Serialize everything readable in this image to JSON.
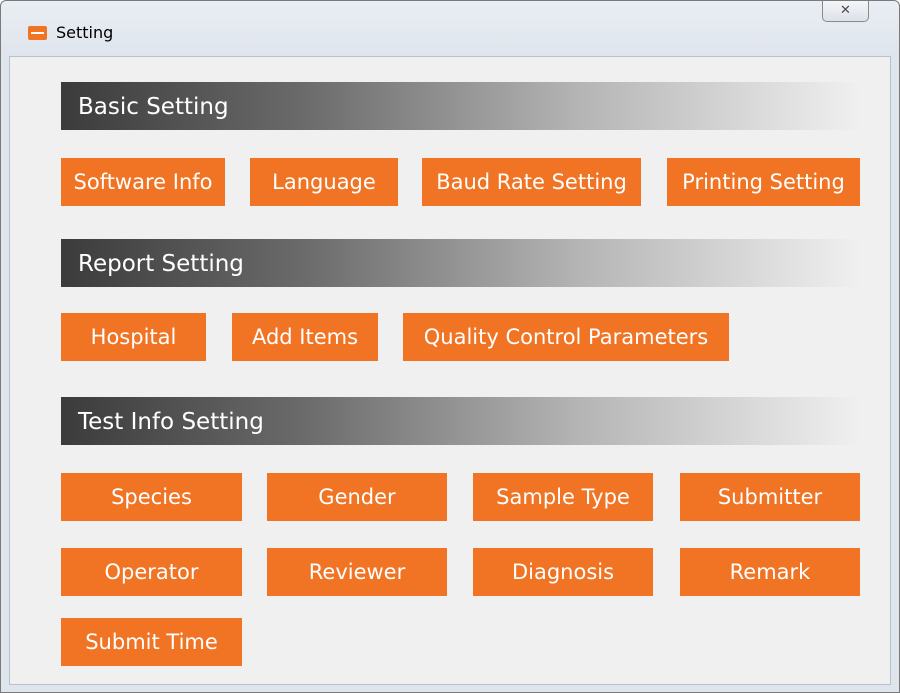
{
  "window": {
    "title": "Setting",
    "close_label": "✕"
  },
  "sections": {
    "basic": {
      "title": "Basic Setting",
      "buttons": [
        "Software Info",
        "Language",
        "Baud Rate Setting",
        "Printing Setting"
      ]
    },
    "report": {
      "title": "Report Setting",
      "buttons": [
        "Hospital",
        "Add Items",
        "Quality Control Parameters"
      ]
    },
    "test_info": {
      "title": "Test Info Setting",
      "buttons": [
        "Species",
        "Gender",
        "Sample Type",
        "Submitter",
        "Operator",
        "Reviewer",
        "Diagnosis",
        "Remark",
        "Submit Time"
      ]
    }
  },
  "colors": {
    "accent": "#f07424",
    "header_dark": "#3b3b3b",
    "background": "#f0f0f0"
  }
}
